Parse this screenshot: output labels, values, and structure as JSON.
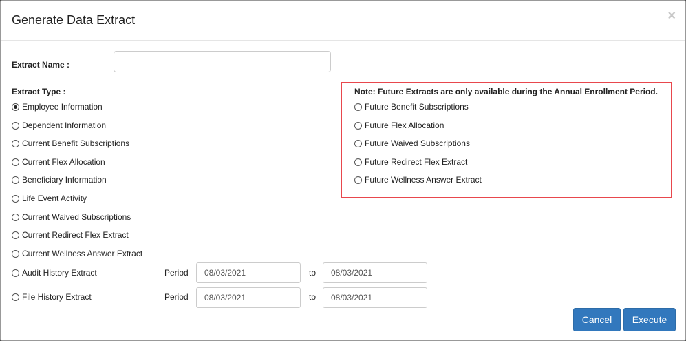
{
  "dialog": {
    "title": "Generate Data Extract",
    "close_label": "×"
  },
  "extract_name": {
    "label": "Extract Name :",
    "value": "",
    "placeholder": ""
  },
  "extract_type": {
    "label": "Extract Type :",
    "selected": "Employee Information",
    "options": [
      "Employee Information",
      "Dependent Information",
      "Current Benefit Subscriptions",
      "Current Flex Allocation",
      "Beneficiary Information",
      "Life Event Activity",
      "Current Waived Subscriptions",
      "Current Redirect Flex Extract",
      "Current Wellness Answer Extract",
      "Audit History Extract",
      "File History Extract"
    ]
  },
  "future": {
    "note": "Note: Future Extracts are only available during the Annual Enrollment Period.",
    "highlight_color": "#e8474d",
    "options": [
      "Future Benefit Subscriptions",
      "Future Flex Allocation",
      "Future Waived Subscriptions",
      "Future Redirect Flex Extract",
      "Future Wellness Answer Extract"
    ]
  },
  "audit_period": {
    "label": "Period",
    "from": "08/03/2021",
    "to_label": "to",
    "to": "08/03/2021"
  },
  "file_period": {
    "label": "Period",
    "from": "08/03/2021",
    "to_label": "to",
    "to": "08/03/2021"
  },
  "buttons": {
    "cancel": "Cancel",
    "execute": "Execute",
    "color": "#3278bd"
  }
}
